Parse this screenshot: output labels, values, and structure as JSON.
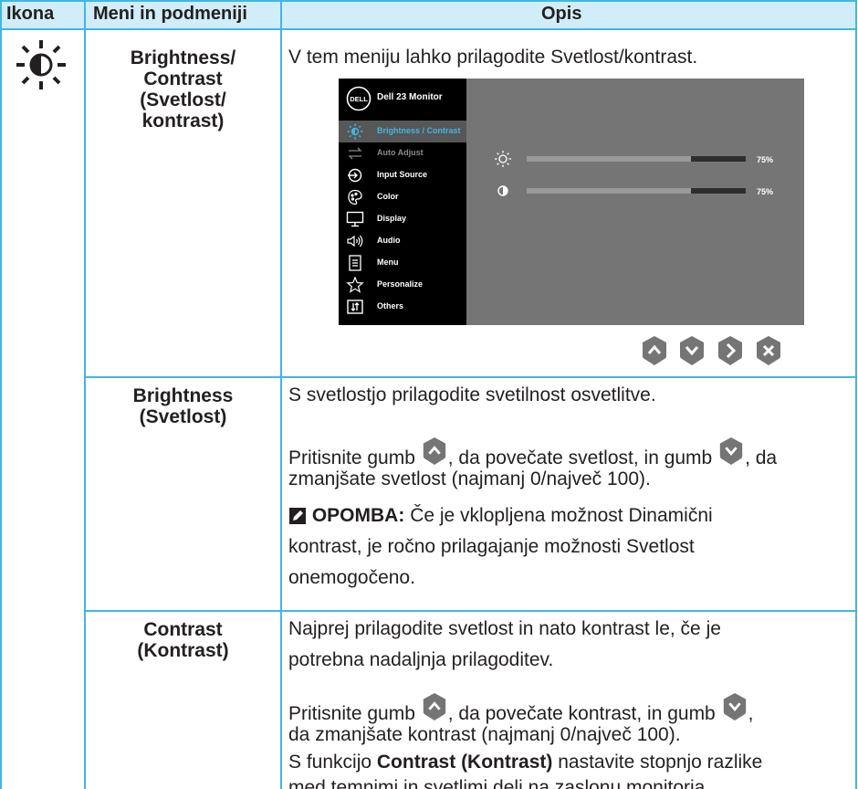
{
  "header": {
    "col_icon": "Ikona",
    "col_menu": "Meni in podmeniji",
    "col_desc": "Opis"
  },
  "rows": {
    "brightness_contrast": {
      "menu_line1": "Brightness/",
      "menu_line2": "Contrast",
      "menu_line3": "(Svetlost/",
      "menu_line4": "kontrast)",
      "description": "V tem meniju lahko prilagodite Svetlost/kontrast."
    },
    "brightness": {
      "menu_line1": "Brightness",
      "menu_line2": "(Svetlost)",
      "p1": "S svetlostjo prilagodite svetilnost osvetlitve.",
      "p2a": "Pritisnite gumb",
      "p2b": ", da povečate svetlost, in gumb",
      "p2c": ", da",
      "p2d": "zmanjšate svetlost (najmanj 0/največ 100).",
      "note_label": "OPOMBA:",
      "note_l1": "Če je vklopljena možnost Dinamični",
      "note_l2": "kontrast, je ročno prilagajanje možnosti Svetlost",
      "note_l3": "onemogočeno."
    },
    "contrast": {
      "menu_line1": "Contrast",
      "menu_line2": "(Kontrast)",
      "p1_l1": "Najprej prilagodite svetlost in nato kontrast le, če je",
      "p1_l2": "potrebna nadaljnja prilagoditev.",
      "p2a": "Pritisnite gumb",
      "p2b": ", da povečate kontrast, in gumb",
      "p2c": ",",
      "p2d": "da zmanjšate kontrast (najmanj 0/največ 100).",
      "p3a": "S funkcijo",
      "p3b": "Contrast (Kontrast)",
      "p3c": "nastavite stopnjo razlike",
      "p3d": "med temnimi in svetlimi deli na zaslonu monitorja."
    }
  },
  "osd": {
    "logo": "DELL",
    "title": "Dell 23 Monitor",
    "menu": [
      {
        "label": "Brightness / Contrast",
        "icon": "sun-icon",
        "selected": true
      },
      {
        "label": "Auto Adjust",
        "icon": "auto-adjust-icon"
      },
      {
        "label": "Input Source",
        "icon": "input-source-icon"
      },
      {
        "label": "Color",
        "icon": "color-palette-icon"
      },
      {
        "label": "Display",
        "icon": "monitor-icon"
      },
      {
        "label": "Audio",
        "icon": "speaker-icon"
      },
      {
        "label": "Menu",
        "icon": "menu-list-icon"
      },
      {
        "label": "Personalize",
        "icon": "star-icon"
      },
      {
        "label": "Others",
        "icon": "others-icon"
      }
    ],
    "brightness_value": "75%",
    "contrast_value": "75%",
    "brightness_level": 0.75,
    "contrast_level": 0.75
  },
  "colors": {
    "accent": "#41b6e6",
    "header_bg": "#d1edf9",
    "osd_bg": "#757575",
    "nav_button": "#757575"
  }
}
